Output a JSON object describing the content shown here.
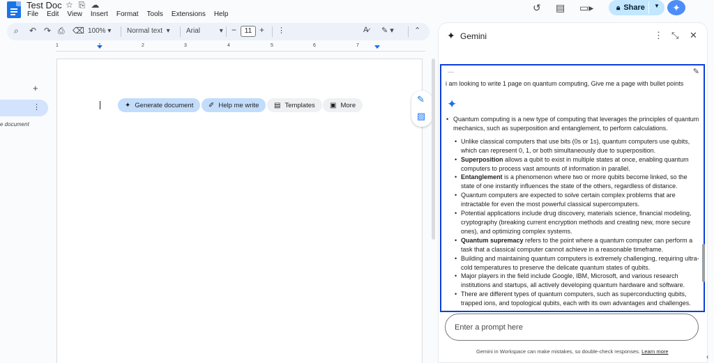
{
  "doc": {
    "title": "Test Doc",
    "menu": [
      "File",
      "Edit",
      "View",
      "Insert",
      "Format",
      "Tools",
      "Extensions",
      "Help"
    ]
  },
  "header": {
    "share_label": "Share"
  },
  "toolbar": {
    "zoom": "100%",
    "style": "Normal text",
    "font": "Arial",
    "font_size": "11"
  },
  "ruler": {
    "numbers": [
      "1",
      "1",
      "2",
      "3",
      "4",
      "5",
      "6",
      "7"
    ]
  },
  "outline": {
    "tab_label": "e document"
  },
  "page": {
    "chips": {
      "generate": "Generate document",
      "help_write": "Help me write",
      "templates": "Templates",
      "more": "More"
    }
  },
  "gemini": {
    "title": "Gemini",
    "query_marker": "—",
    "query": "i am looking to write 1 page on quantum computing, Give me a page with bullet points",
    "intro": "Quantum computing is a new type of computing that leverages the principles of quantum mechanics, such as superposition and entanglement, to perform calculations.",
    "bullets": [
      {
        "bold": "",
        "text": "Unlike classical computers that use bits (0s or 1s), quantum computers use qubits, which can represent 0, 1, or both simultaneously due to superposition."
      },
      {
        "bold": "Superposition",
        "text": " allows a qubit to exist in multiple states at once, enabling quantum computers to process vast amounts of information in parallel."
      },
      {
        "bold": "Entanglement",
        "text": " is a phenomenon where two or more qubits become linked, so the state of one instantly influences the state of the others, regardless of distance."
      },
      {
        "bold": "",
        "text": "Quantum computers are expected to solve certain complex problems that are intractable for even the most powerful classical supercomputers."
      },
      {
        "bold": "",
        "text": "Potential applications include drug discovery, materials science, financial modeling, cryptography (breaking current encryption methods and creating new, more secure ones), and optimizing complex systems."
      },
      {
        "bold": "Quantum supremacy",
        "text": " refers to the point where a quantum computer can perform a task that a classical computer cannot achieve in a reasonable timeframe."
      },
      {
        "bold": "",
        "text": "Building and maintaining quantum computers is extremely challenging, requiring ultra-cold temperatures to preserve the delicate quantum states of qubits."
      },
      {
        "bold": "",
        "text": "Major players in the field include Google, IBM, Microsoft, and various research institutions and startups, all actively developing quantum hardware and software."
      },
      {
        "bold": "",
        "text": "There are different types of quantum computers, such as superconducting qubits, trapped ions, and topological qubits, each with its own advantages and challenges."
      }
    ],
    "prompt_placeholder": "Enter a prompt here",
    "disclaimer": "Gemini in Workspace can make mistakes, so double-check responses.",
    "learn_more": "Learn more"
  },
  "colors": {
    "accent": "#1a73e8",
    "share_bg": "#c2e7ff",
    "highlight_border": "#0b3fd9"
  }
}
